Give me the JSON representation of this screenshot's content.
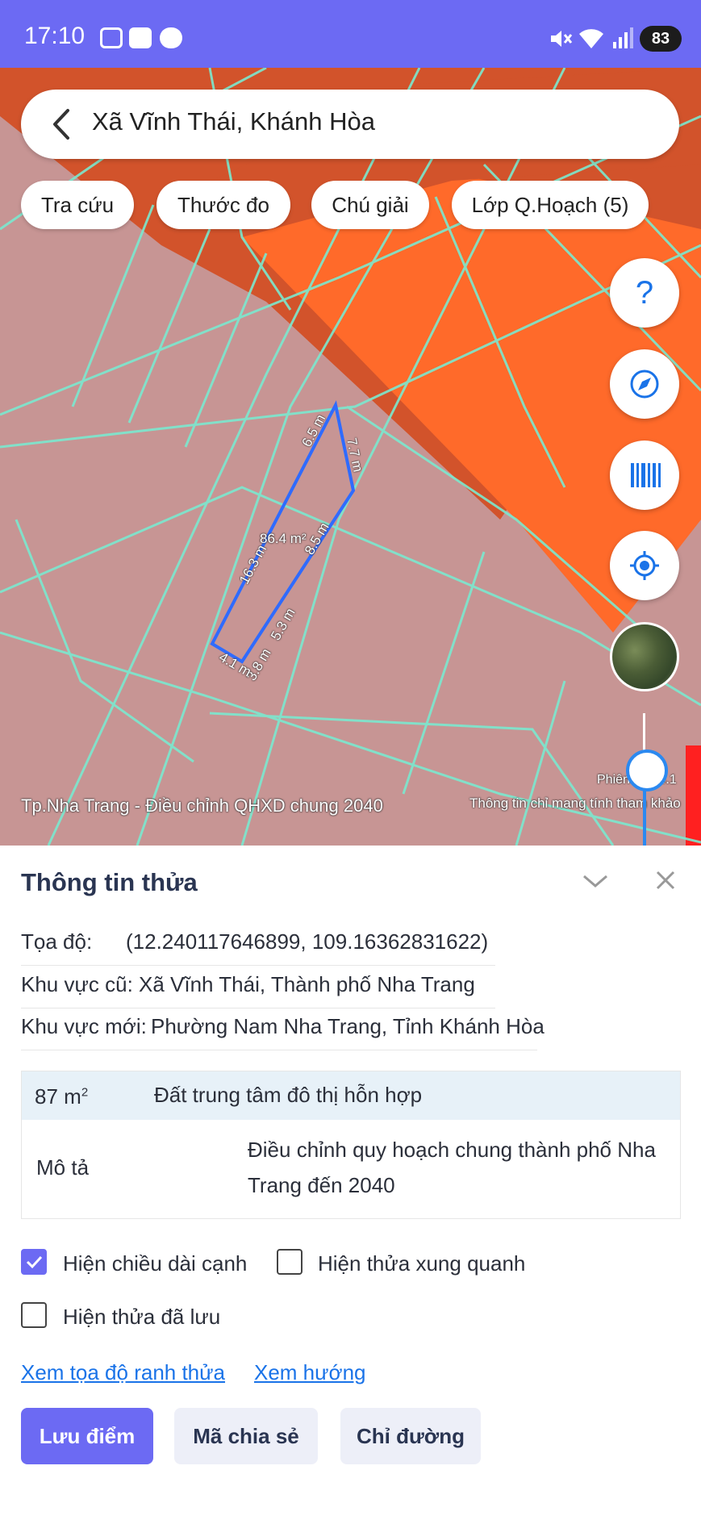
{
  "status_bar": {
    "time": "17:10",
    "battery": "83",
    "left_icons": [
      "screenshot-icon",
      "zalo-icon",
      "messenger-icon"
    ],
    "right_icons": [
      "mute-icon",
      "wifi-icon",
      "signal-icon",
      "battery-icon"
    ]
  },
  "search": {
    "title": "Xã Vĩnh Thái, Khánh Hòa"
  },
  "chips": [
    "Tra cứu",
    "Thước đo",
    "Chú giải",
    "Lớp Q.Hoạch (5)"
  ],
  "map": {
    "parcel_labels": {
      "area": "86.4 m²",
      "edge_a": "6.5 m",
      "edge_b": "7.7 m",
      "edge_c": "8.5 m",
      "edge_d": "16.3 m",
      "edge_e": "5.3 m",
      "edge_f": "3.8 m",
      "edge_g": "4.1 m"
    },
    "plan_name": "Tp.Nha Trang - Điều chỉnh QHXD chung 2040",
    "version_text": "Phiên bản 4.1",
    "disclaimer": "Thông tin chỉ mang tính tham khảo",
    "colors": {
      "land": "#c79594",
      "commercial": "#ff6a2a",
      "border": "#7be9cf",
      "parcel": "#2f6bff"
    }
  },
  "panel": {
    "title": "Thông tin thửa",
    "coord_label": "Tọa độ:",
    "coord_value": "(12.240117646899, 109.16362831622)",
    "old_area_label": "Khu vực cũ:",
    "old_area_value": "Xã Vĩnh Thái, Thành phố Nha Trang",
    "new_area_label": "Khu vực mới:",
    "new_area_value": "Phường Nam Nha Trang, Tỉnh Khánh Hòa",
    "table": {
      "area": "87 m",
      "area_sup": "2",
      "land_type": "Đất trung tâm đô thị hỗn hợp",
      "desc_label": "Mô tả",
      "desc_line1": "Điều chỉnh quy hoạch chung thành phố Nha",
      "desc_line2": "Trang đến 2040"
    },
    "checkbox_edges": "Hiện chiều dài cạnh",
    "checkbox_edges_checked": true,
    "checkbox_neighbors": "Hiện thửa xung quanh",
    "checkbox_neighbors_checked": false,
    "checkbox_saved": "Hiện thửa đã lưu",
    "checkbox_saved_checked": false,
    "link_coords": "Xem tọa độ ranh thửa",
    "link_direction": "Xem hướng",
    "btn_save": "Lưu điểm",
    "btn_share": "Mã chia sẻ",
    "btn_route": "Chỉ đường"
  }
}
